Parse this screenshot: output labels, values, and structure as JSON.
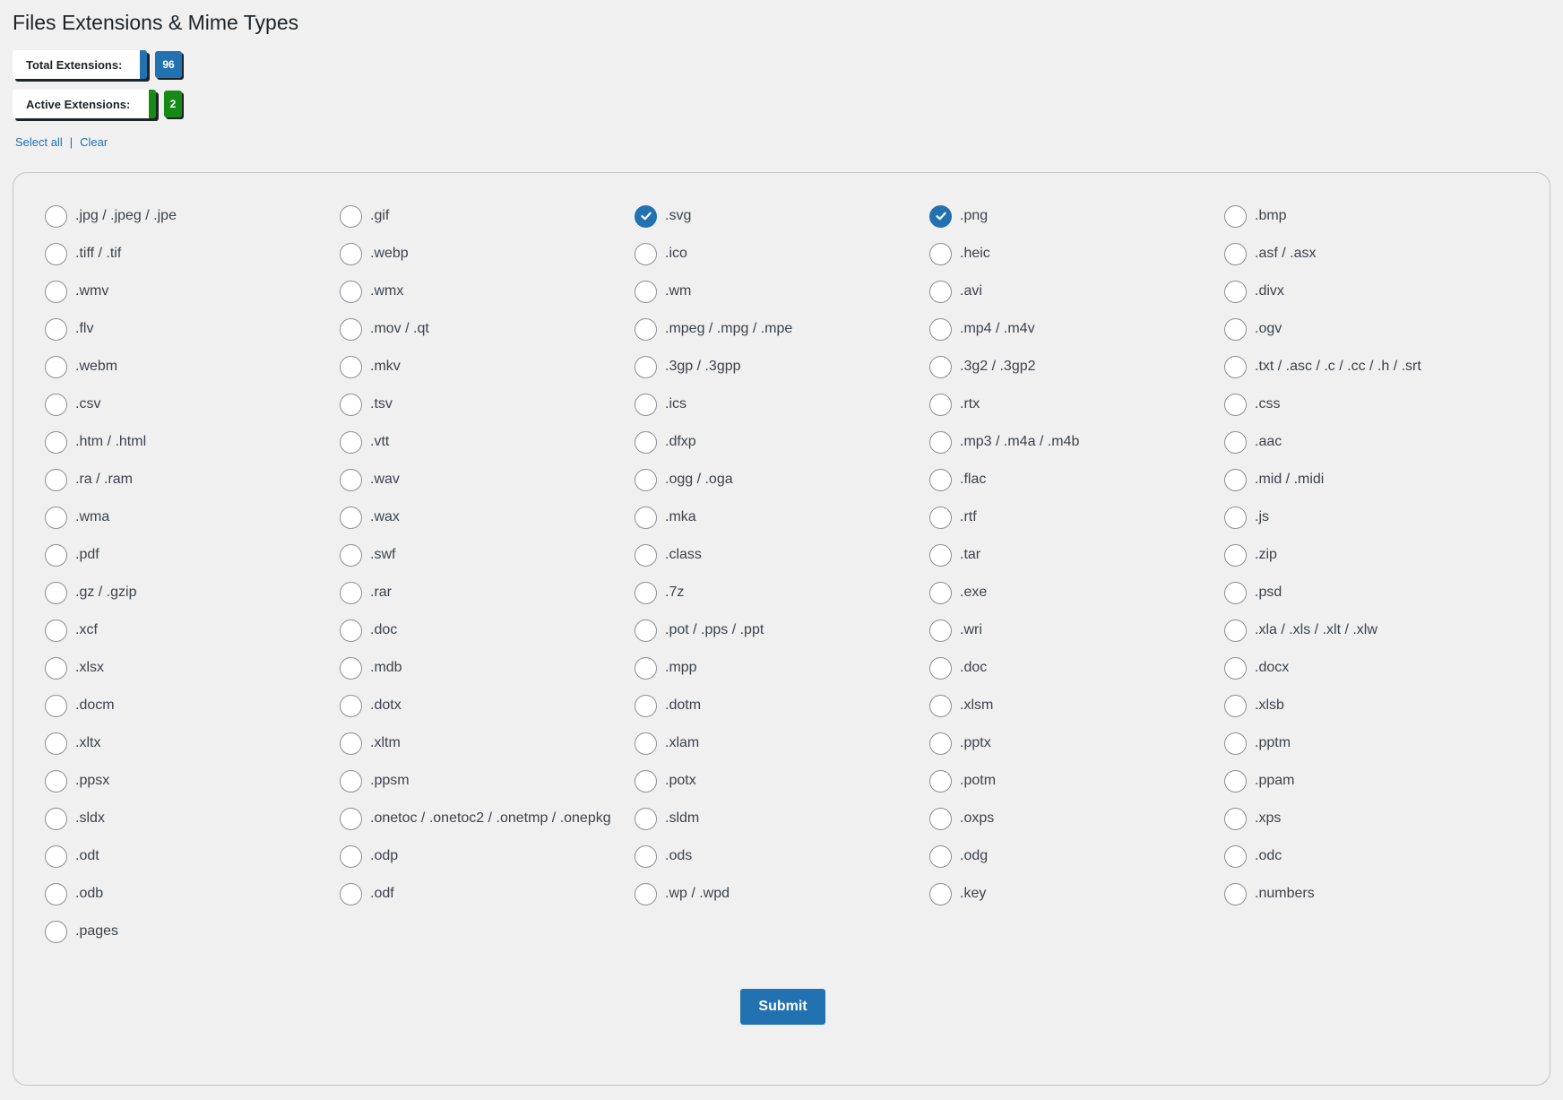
{
  "page_title": "Files Extensions & Mime Types",
  "stats": {
    "total_label": "Total Extensions:",
    "total_count": "96",
    "active_label": "Active Extensions:",
    "active_count": "2"
  },
  "links": {
    "select_all": "Select all",
    "separator": "|",
    "clear": "Clear"
  },
  "accent_color": "#2271b1",
  "active_color": "#168a16",
  "extensions": [
    {
      "label": ".jpg / .jpeg / .jpe",
      "checked": false
    },
    {
      "label": ".gif",
      "checked": false
    },
    {
      "label": ".svg",
      "checked": true
    },
    {
      "label": ".png",
      "checked": true
    },
    {
      "label": ".bmp",
      "checked": false
    },
    {
      "label": ".tiff / .tif",
      "checked": false
    },
    {
      "label": ".webp",
      "checked": false
    },
    {
      "label": ".ico",
      "checked": false
    },
    {
      "label": ".heic",
      "checked": false
    },
    {
      "label": ".asf / .asx",
      "checked": false
    },
    {
      "label": ".wmv",
      "checked": false
    },
    {
      "label": ".wmx",
      "checked": false
    },
    {
      "label": ".wm",
      "checked": false
    },
    {
      "label": ".avi",
      "checked": false
    },
    {
      "label": ".divx",
      "checked": false
    },
    {
      "label": ".flv",
      "checked": false
    },
    {
      "label": ".mov / .qt",
      "checked": false
    },
    {
      "label": ".mpeg / .mpg / .mpe",
      "checked": false
    },
    {
      "label": ".mp4 / .m4v",
      "checked": false
    },
    {
      "label": ".ogv",
      "checked": false
    },
    {
      "label": ".webm",
      "checked": false
    },
    {
      "label": ".mkv",
      "checked": false
    },
    {
      "label": ".3gp / .3gpp",
      "checked": false
    },
    {
      "label": ".3g2 / .3gp2",
      "checked": false
    },
    {
      "label": ".txt / .asc / .c / .cc / .h / .srt",
      "checked": false
    },
    {
      "label": ".csv",
      "checked": false
    },
    {
      "label": ".tsv",
      "checked": false
    },
    {
      "label": ".ics",
      "checked": false
    },
    {
      "label": ".rtx",
      "checked": false
    },
    {
      "label": ".css",
      "checked": false
    },
    {
      "label": ".htm / .html",
      "checked": false
    },
    {
      "label": ".vtt",
      "checked": false
    },
    {
      "label": ".dfxp",
      "checked": false
    },
    {
      "label": ".mp3 / .m4a / .m4b",
      "checked": false
    },
    {
      "label": ".aac",
      "checked": false
    },
    {
      "label": ".ra / .ram",
      "checked": false
    },
    {
      "label": ".wav",
      "checked": false
    },
    {
      "label": ".ogg / .oga",
      "checked": false
    },
    {
      "label": ".flac",
      "checked": false
    },
    {
      "label": ".mid / .midi",
      "checked": false
    },
    {
      "label": ".wma",
      "checked": false
    },
    {
      "label": ".wax",
      "checked": false
    },
    {
      "label": ".mka",
      "checked": false
    },
    {
      "label": ".rtf",
      "checked": false
    },
    {
      "label": ".js",
      "checked": false
    },
    {
      "label": ".pdf",
      "checked": false
    },
    {
      "label": ".swf",
      "checked": false
    },
    {
      "label": ".class",
      "checked": false
    },
    {
      "label": ".tar",
      "checked": false
    },
    {
      "label": ".zip",
      "checked": false
    },
    {
      "label": ".gz / .gzip",
      "checked": false
    },
    {
      "label": ".rar",
      "checked": false
    },
    {
      "label": ".7z",
      "checked": false
    },
    {
      "label": ".exe",
      "checked": false
    },
    {
      "label": ".psd",
      "checked": false
    },
    {
      "label": ".xcf",
      "checked": false
    },
    {
      "label": ".doc",
      "checked": false
    },
    {
      "label": ".pot / .pps / .ppt",
      "checked": false
    },
    {
      "label": ".wri",
      "checked": false
    },
    {
      "label": ".xla / .xls / .xlt / .xlw",
      "checked": false
    },
    {
      "label": ".xlsx",
      "checked": false
    },
    {
      "label": ".mdb",
      "checked": false
    },
    {
      "label": ".mpp",
      "checked": false
    },
    {
      "label": ".doc",
      "checked": false
    },
    {
      "label": ".docx",
      "checked": false
    },
    {
      "label": ".docm",
      "checked": false
    },
    {
      "label": ".dotx",
      "checked": false
    },
    {
      "label": ".dotm",
      "checked": false
    },
    {
      "label": ".xlsm",
      "checked": false
    },
    {
      "label": ".xlsb",
      "checked": false
    },
    {
      "label": ".xltx",
      "checked": false
    },
    {
      "label": ".xltm",
      "checked": false
    },
    {
      "label": ".xlam",
      "checked": false
    },
    {
      "label": ".pptx",
      "checked": false
    },
    {
      "label": ".pptm",
      "checked": false
    },
    {
      "label": ".ppsx",
      "checked": false
    },
    {
      "label": ".ppsm",
      "checked": false
    },
    {
      "label": ".potx",
      "checked": false
    },
    {
      "label": ".potm",
      "checked": false
    },
    {
      "label": ".ppam",
      "checked": false
    },
    {
      "label": ".sldx",
      "checked": false
    },
    {
      "label": ".onetoc / .onetoc2 / .onetmp / .onepkg",
      "checked": false
    },
    {
      "label": ".sldm",
      "checked": false
    },
    {
      "label": ".oxps",
      "checked": false
    },
    {
      "label": ".xps",
      "checked": false
    },
    {
      "label": ".odt",
      "checked": false
    },
    {
      "label": ".odp",
      "checked": false
    },
    {
      "label": ".ods",
      "checked": false
    },
    {
      "label": ".odg",
      "checked": false
    },
    {
      "label": ".odc",
      "checked": false
    },
    {
      "label": ".odb",
      "checked": false
    },
    {
      "label": ".odf",
      "checked": false
    },
    {
      "label": ".wp / .wpd",
      "checked": false
    },
    {
      "label": ".key",
      "checked": false
    },
    {
      "label": ".numbers",
      "checked": false
    },
    {
      "label": ".pages",
      "checked": false
    }
  ],
  "submit_label": "Submit"
}
